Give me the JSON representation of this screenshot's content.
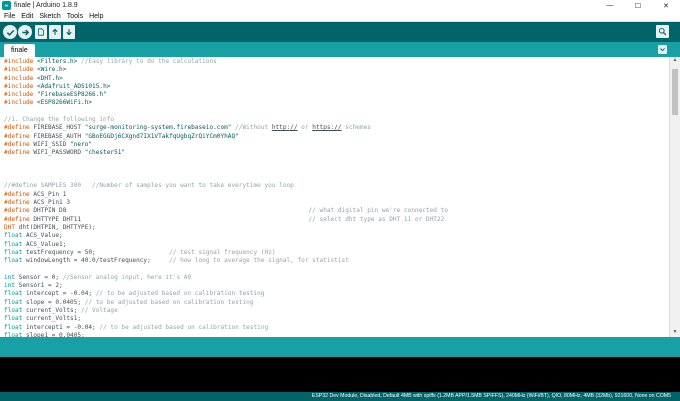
{
  "window": {
    "title": "finale | Arduino 1.8.9",
    "app_icon_text": "∞",
    "minimize_label": "—",
    "maximize_label": "☐",
    "close_label": "✕"
  },
  "menu": {
    "items": [
      "File",
      "Edit",
      "Sketch",
      "Tools",
      "Help"
    ]
  },
  "toolbar": {
    "buttons": [
      "verify",
      "upload",
      "new",
      "open",
      "save"
    ],
    "serial_monitor": "serial-monitor"
  },
  "tabs": {
    "active": "finale"
  },
  "editor": {
    "lines": [
      [
        [
          "kw2",
          "#include"
        ],
        [
          "",
          " "
        ],
        [
          "str",
          "<Filters.h>"
        ],
        [
          "",
          " "
        ],
        [
          "cmt",
          "//Easy library to do the calculations"
        ]
      ],
      [
        [
          "kw2",
          "#include"
        ],
        [
          "",
          " "
        ],
        [
          "str",
          "<Wire.h>"
        ]
      ],
      [
        [
          "kw2",
          "#include"
        ],
        [
          "",
          " "
        ],
        [
          "str",
          "<DHT.h>"
        ]
      ],
      [
        [
          "kw2",
          "#include"
        ],
        [
          "",
          " "
        ],
        [
          "str",
          "<Adafruit_ADS1015.h>"
        ]
      ],
      [
        [
          "kw2",
          "#include"
        ],
        [
          "",
          " "
        ],
        [
          "str",
          "\"FirebaseESP8266.h\""
        ]
      ],
      [
        [
          "kw2",
          "#include"
        ],
        [
          "",
          " "
        ],
        [
          "str",
          "<ESP8266WiFi.h>"
        ]
      ],
      [],
      [
        [
          "cmt",
          "//1. Change the following info"
        ]
      ],
      [
        [
          "kw2",
          "#define"
        ],
        [
          "",
          " FIREBASE_HOST "
        ],
        [
          "str",
          "\"surge-monitoring-system.firebaseio.com\""
        ],
        [
          "",
          " "
        ],
        [
          "cmt",
          "//Without "
        ],
        [
          "lnk",
          "http://"
        ],
        [
          "cmt",
          " or "
        ],
        [
          "lnk",
          "https://"
        ],
        [
          "cmt",
          " schemes"
        ]
      ],
      [
        [
          "kw2",
          "#define"
        ],
        [
          "",
          " FIREBASE_AUTH "
        ],
        [
          "str",
          "\"GBoEGGDj6CXgnd7IX1VTakfqUgbqZrQiYCm0YhAQ\""
        ]
      ],
      [
        [
          "kw2",
          "#define"
        ],
        [
          "",
          " WIFI_SSID "
        ],
        [
          "str",
          "\"nero\""
        ]
      ],
      [
        [
          "kw2",
          "#define"
        ],
        [
          "",
          " WIFI_PASSWORD "
        ],
        [
          "str",
          "\"chester51\""
        ]
      ],
      [],
      [],
      [],
      [
        [
          "cmt",
          "//#define SAMPLES 300   //Number of samples you want to take everytime you loop"
        ]
      ],
      [
        [
          "kw2",
          "#define"
        ],
        [
          "",
          " ACS_Pin 1"
        ]
      ],
      [
        [
          "kw2",
          "#define"
        ],
        [
          "",
          " ACS_Pin1 3"
        ]
      ],
      [
        [
          "kw2",
          "#define"
        ],
        [
          "",
          " DHTPIN D8                                                                  "
        ],
        [
          "cmt",
          "// what digital pin we're connected to"
        ]
      ],
      [
        [
          "kw2",
          "#define"
        ],
        [
          "",
          " DHTTYPE DHT11                                                              "
        ],
        [
          "cmt",
          "// select dht type as DHT 11 or DHT22"
        ]
      ],
      [
        [
          "kw2",
          "DHT"
        ],
        [
          "",
          " dht(DHTPIN, DHTTYPE);"
        ]
      ],
      [
        [
          "kw",
          "float"
        ],
        [
          "",
          " ACS_Value;"
        ]
      ],
      [
        [
          "kw",
          "float"
        ],
        [
          "",
          " ACS_Value1;"
        ]
      ],
      [
        [
          "kw",
          "float"
        ],
        [
          "",
          " testFrequency = 50;                    "
        ],
        [
          "cmt",
          "// test signal frequency (Hz)"
        ]
      ],
      [
        [
          "kw",
          "float"
        ],
        [
          "",
          " windowLength = 40.0/testFrequency;     "
        ],
        [
          "cmt",
          "// how long to average the signal, for statistist"
        ]
      ],
      [],
      [
        [
          "kw",
          "int"
        ],
        [
          "",
          " Sensor = 0; "
        ],
        [
          "cmt",
          "//Sensor analog input, here it's A0"
        ]
      ],
      [
        [
          "kw",
          "int"
        ],
        [
          "",
          " Sensor1 = 2;"
        ]
      ],
      [
        [
          "kw",
          "float"
        ],
        [
          "",
          " intercept = -0.04; "
        ],
        [
          "cmt",
          "// to be adjusted based on calibration testing"
        ]
      ],
      [
        [
          "kw",
          "float"
        ],
        [
          "",
          " slope = 0.0405; "
        ],
        [
          "cmt",
          "// to be adjusted based on calibration testing"
        ]
      ],
      [
        [
          "kw",
          "float"
        ],
        [
          "",
          " current_Volts; "
        ],
        [
          "cmt",
          "// Voltage"
        ]
      ],
      [
        [
          "kw",
          "float"
        ],
        [
          "",
          " current_Volts1;"
        ]
      ],
      [
        [
          "kw",
          "float"
        ],
        [
          "",
          " intercept1 = -0.04; "
        ],
        [
          "cmt",
          "// to be adjusted based on calibration testing"
        ]
      ],
      [
        [
          "kw",
          "float"
        ],
        [
          "",
          " slope1 = 0.0405;"
        ]
      ]
    ]
  },
  "status": {
    "board_info": "ESP32 Dev Module, Disabled, Default 4MB with spiffs (1.2MB APP/1.5MB SPIFFS), 240MHz (WiFi/BT), QIO, 80MHz, 4MB (32Mb), 921600, None on COM5"
  }
}
